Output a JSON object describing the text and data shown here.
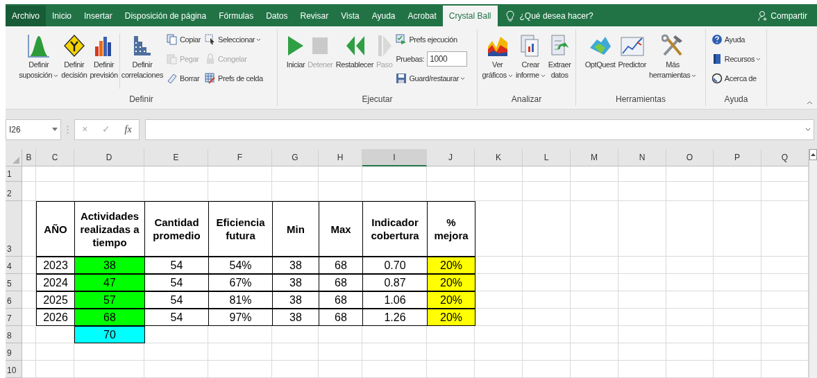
{
  "tabs": [
    {
      "label": "Archivo",
      "selected": false,
      "kind": "file"
    },
    {
      "label": "Inicio",
      "selected": false
    },
    {
      "label": "Insertar",
      "selected": false
    },
    {
      "label": "Disposición de página",
      "selected": false
    },
    {
      "label": "Fórmulas",
      "selected": false
    },
    {
      "label": "Datos",
      "selected": false
    },
    {
      "label": "Revisar",
      "selected": false
    },
    {
      "label": "Vista",
      "selected": false
    },
    {
      "label": "Ayuda",
      "selected": false
    },
    {
      "label": "Acrobat",
      "selected": false
    },
    {
      "label": "Crystal Ball",
      "selected": true
    }
  ],
  "tell_me": "¿Qué desea hacer?",
  "share": "Compartir",
  "ribbon": [
    {
      "label": "Definir",
      "items": [
        {
          "kind": "large",
          "label": "Definir\nsuposición",
          "dropdown": true,
          "disabled": false
        },
        {
          "kind": "large",
          "label": "Definir\ndecisión",
          "dropdown": false,
          "disabled": false
        },
        {
          "kind": "large",
          "label": "Definir\nprevisión",
          "dropdown": false,
          "disabled": false
        },
        {
          "kind": "separator"
        },
        {
          "kind": "large",
          "label": "Definir\ncorrelaciones",
          "dropdown": false,
          "disabled": false
        },
        {
          "kind": "stack",
          "items": [
            {
              "kind": "small",
              "label": "Copiar",
              "dropdown": false,
              "disabled": false
            },
            {
              "kind": "small",
              "label": "Pegar",
              "dropdown": false,
              "disabled": true
            },
            {
              "kind": "small",
              "label": "Borrar",
              "dropdown": false,
              "disabled": false
            }
          ]
        },
        {
          "kind": "stack",
          "items": [
            {
              "kind": "small",
              "label": "Seleccionar",
              "dropdown": true,
              "disabled": false
            },
            {
              "kind": "small",
              "label": "Congelar",
              "dropdown": false,
              "disabled": true
            },
            {
              "kind": "small",
              "label": "Prefs de celda",
              "dropdown": false,
              "disabled": false
            }
          ]
        }
      ]
    },
    {
      "label": "Ejecutar",
      "items": [
        {
          "kind": "large",
          "label": "Iniciar",
          "dropdown": false,
          "disabled": false
        },
        {
          "kind": "large",
          "label": "Detener",
          "dropdown": false,
          "disabled": true
        },
        {
          "kind": "large",
          "label": "Restablecer",
          "dropdown": false,
          "disabled": false
        },
        {
          "kind": "large",
          "label": "Paso",
          "dropdown": false,
          "disabled": true
        },
        {
          "kind": "stack",
          "items": [
            {
              "kind": "small",
              "label": "Prefs ejecución",
              "dropdown": false,
              "disabled": false
            },
            {
              "kind": "field",
              "label": "Pruebas:",
              "value": "1000"
            },
            {
              "kind": "small",
              "label": "Guard/restaurar",
              "dropdown": true,
              "disabled": false
            }
          ]
        }
      ]
    },
    {
      "label": "Analizar",
      "items": [
        {
          "kind": "large",
          "label": "Ver\ngráficos",
          "dropdown": true,
          "disabled": false
        },
        {
          "kind": "large",
          "label": "Crear\ninforme",
          "dropdown": true,
          "disabled": false
        },
        {
          "kind": "large",
          "label": "Extraer\ndatos",
          "dropdown": false,
          "disabled": false
        }
      ]
    },
    {
      "label": "Herramientas",
      "items": [
        {
          "kind": "large",
          "label": "OptQuest",
          "dropdown": false,
          "disabled": false
        },
        {
          "kind": "large",
          "label": "Predictor",
          "dropdown": false,
          "disabled": false
        },
        {
          "kind": "large",
          "label": "Más\nherramientas",
          "dropdown": true,
          "disabled": false
        }
      ]
    },
    {
      "label": "Ayuda",
      "items": [
        {
          "kind": "stack",
          "items": [
            {
              "kind": "small",
              "label": "Ayuda",
              "dropdown": false,
              "disabled": false
            },
            {
              "kind": "small",
              "label": "Recursos",
              "dropdown": true,
              "disabled": false
            },
            {
              "kind": "small",
              "label": "Acerca de",
              "dropdown": false,
              "disabled": false
            }
          ]
        }
      ]
    }
  ],
  "formula_bar": {
    "name_box": "I26",
    "cancel": "×",
    "enter": "✓",
    "function": "fx"
  },
  "sheet": {
    "columns": [
      {
        "label": "B",
        "selected": false
      },
      {
        "label": "C",
        "selected": false
      },
      {
        "label": "D",
        "selected": false
      },
      {
        "label": "E",
        "selected": false
      },
      {
        "label": "F",
        "selected": false
      },
      {
        "label": "G",
        "selected": false
      },
      {
        "label": "H",
        "selected": false
      },
      {
        "label": "I",
        "selected": true
      },
      {
        "label": "J",
        "selected": false
      },
      {
        "label": "K",
        "selected": false
      },
      {
        "label": "L",
        "selected": false
      },
      {
        "label": "M",
        "selected": false
      },
      {
        "label": "N",
        "selected": false
      },
      {
        "label": "O",
        "selected": false
      },
      {
        "label": "P",
        "selected": false
      },
      {
        "label": "Q",
        "selected": false
      }
    ],
    "rows": [
      {
        "number": "1"
      },
      {
        "number": "2"
      },
      {
        "number": "3",
        "kind": "header",
        "cells": [
          {
            "text": "AÑO"
          },
          {
            "text": "Actividades realizadas a tiempo"
          },
          {
            "text": "Cantidad promedio"
          },
          {
            "text": "Eficiencia futura"
          },
          {
            "text": "Min"
          },
          {
            "text": "Max"
          },
          {
            "text": "Indicador cobertura"
          },
          {
            "text": "% mejora"
          }
        ]
      },
      {
        "number": "4",
        "kind": "data",
        "cells": [
          {
            "text": "2023"
          },
          {
            "text": "38",
            "color": "#00ff00"
          },
          {
            "text": "54"
          },
          {
            "text": "54%"
          },
          {
            "text": "38"
          },
          {
            "text": "68"
          },
          {
            "text": "0.70"
          },
          {
            "text": "20%",
            "color": "#ffff00"
          }
        ]
      },
      {
        "number": "5",
        "kind": "data",
        "cells": [
          {
            "text": "2024"
          },
          {
            "text": "47",
            "color": "#00ff00"
          },
          {
            "text": "54"
          },
          {
            "text": "67%"
          },
          {
            "text": "38"
          },
          {
            "text": "68"
          },
          {
            "text": "0.87"
          },
          {
            "text": "20%",
            "color": "#ffff00"
          }
        ]
      },
      {
        "number": "6",
        "kind": "data",
        "cells": [
          {
            "text": "2025"
          },
          {
            "text": "57",
            "color": "#00ff00"
          },
          {
            "text": "54"
          },
          {
            "text": "81%"
          },
          {
            "text": "38"
          },
          {
            "text": "68"
          },
          {
            "text": "1.06"
          },
          {
            "text": "20%",
            "color": "#ffff00"
          }
        ]
      },
      {
        "number": "7",
        "kind": "data",
        "cells": [
          {
            "text": "2026"
          },
          {
            "text": "68",
            "color": "#00ff00"
          },
          {
            "text": "54"
          },
          {
            "text": "97%"
          },
          {
            "text": "38"
          },
          {
            "text": "68"
          },
          {
            "text": "1.26"
          },
          {
            "text": "20%",
            "color": "#ffff00"
          }
        ]
      },
      {
        "number": "8",
        "kind": "data",
        "cells": [
          {},
          {
            "text": "70",
            "color": "#00ffff"
          }
        ]
      },
      {
        "number": "9"
      },
      {
        "number": "10"
      }
    ]
  }
}
